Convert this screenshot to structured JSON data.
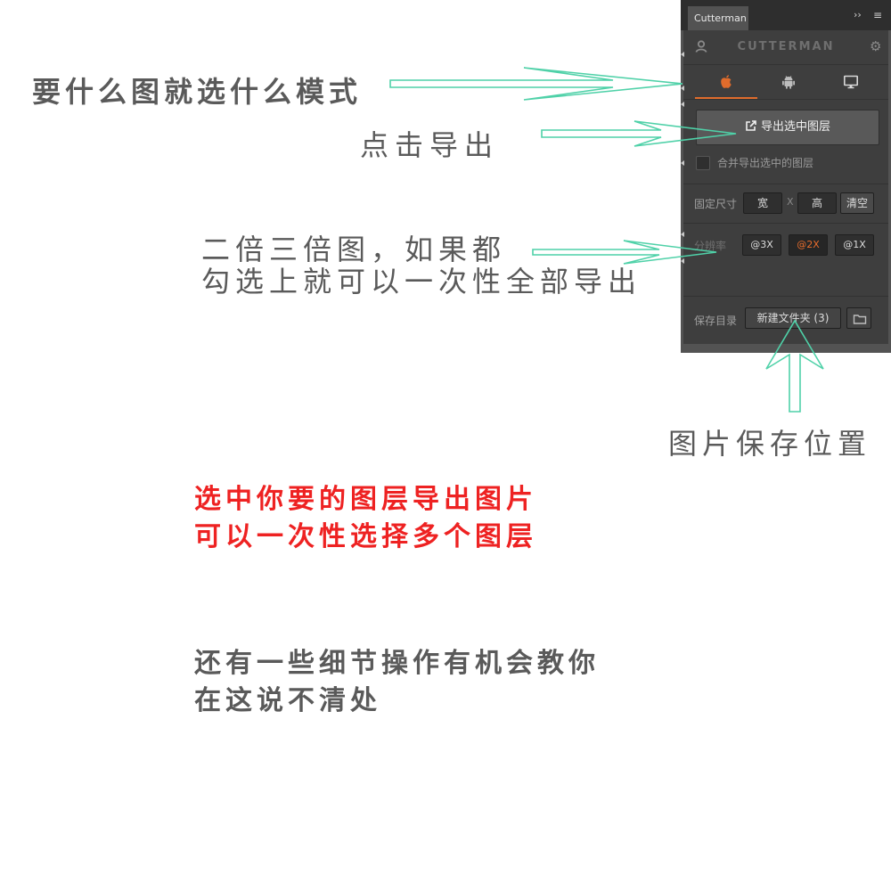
{
  "annotations": {
    "mode_tip": "要什么图就选什么模式",
    "export_tip": "点击导出",
    "scale_tip_line1": "二倍三倍图，如果都",
    "scale_tip_line2": "勾选上就可以一次性全部导出",
    "save_location_tip": "图片保存位置",
    "select_tip_line1": "选中你要的图层导出图片",
    "select_tip_line2": "可以一次性选择多个图层",
    "detail_tip_line1": "还有一些细节操作有机会教你",
    "detail_tip_line2": "在这说不清处"
  },
  "panel": {
    "tab_title": "Cutterman",
    "expand_glyph": "››",
    "menu_glyph": "≡",
    "brand": "CUTTERMAN",
    "mode_tabs": [
      {
        "icon": "apple-icon",
        "active": true
      },
      {
        "icon": "android-icon",
        "active": false
      },
      {
        "icon": "desktop-icon",
        "active": false
      }
    ],
    "export_button": "导出选中图层",
    "merge_checkbox_label": "合并导出选中的图层",
    "merge_checked": false,
    "fixed_size_label": "固定尺寸",
    "width_field": "宽",
    "size_separator": "X",
    "height_field": "高",
    "clear_button": "清空",
    "resolution_label": "分辨率",
    "scales": [
      {
        "label": "@3X",
        "selected": false
      },
      {
        "label": "@2X",
        "selected": true
      },
      {
        "label": "@1X",
        "selected": false
      }
    ],
    "save_dir_label": "保存目录",
    "folder_name": "新建文件夹 (3)"
  },
  "colors": {
    "annotation_gray": "#5a5a5a",
    "annotation_red": "#ee2222",
    "arrow": "#4fd1a8",
    "accent": "#e06c2c"
  }
}
